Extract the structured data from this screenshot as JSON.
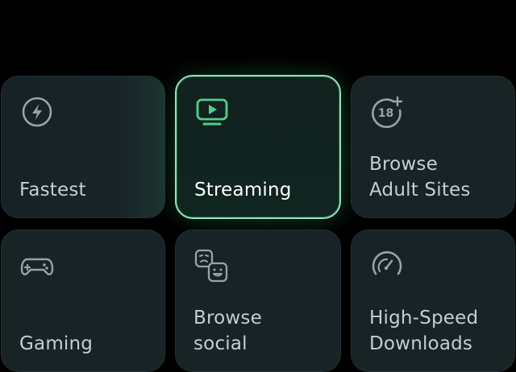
{
  "tiles": [
    {
      "id": "fastest",
      "label": "Fastest",
      "icon": "lightning-icon",
      "selected": false
    },
    {
      "id": "streaming",
      "label": "Streaming",
      "icon": "tv-play-icon",
      "selected": true
    },
    {
      "id": "adult",
      "label": "Browse\nAdult Sites",
      "icon": "eighteen-plus-icon",
      "icon_text": "18",
      "selected": false
    },
    {
      "id": "gaming",
      "label": "Gaming",
      "icon": "gamepad-icon",
      "selected": false
    },
    {
      "id": "social",
      "label": "Browse\nsocial",
      "icon": "emoji-faces-icon",
      "selected": false
    },
    {
      "id": "downloads",
      "label": "High-Speed\nDownloads",
      "icon": "speedometer-icon",
      "selected": false
    }
  ],
  "colors": {
    "background": "#000000",
    "tile": "#182326",
    "accent": "#4fd08a",
    "selected_border": "#8fe6b7",
    "label": "#c7cdd1",
    "icon": "#9aa2a7"
  }
}
